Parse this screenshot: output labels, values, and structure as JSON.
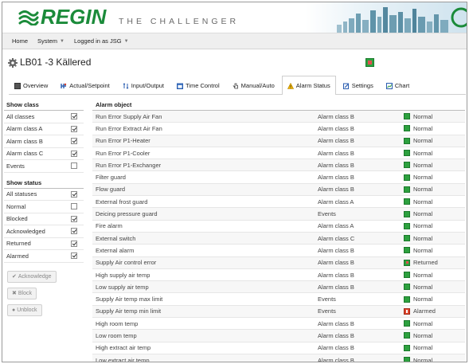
{
  "brand": {
    "logo_text": "REGIN",
    "tagline": "THE CHALLENGER",
    "logo_color": "#1b8b3a"
  },
  "menu": {
    "items": [
      {
        "label": "Home",
        "has_dropdown": false
      },
      {
        "label": "System",
        "has_dropdown": true
      },
      {
        "label": "Logged in as JSG",
        "has_dropdown": true
      }
    ]
  },
  "device": {
    "title": "LB01 -3 Källered",
    "icon": "gear-icon",
    "status_color": "#2da13f"
  },
  "tabs": [
    {
      "label": "Overview",
      "icon": "overview-icon",
      "active": false
    },
    {
      "label": "Actual/Setpoint",
      "icon": "actual-setpoint-icon",
      "active": false
    },
    {
      "label": "Input/Output",
      "icon": "input-output-icon",
      "active": false
    },
    {
      "label": "Time Control",
      "icon": "calendar-icon",
      "active": false
    },
    {
      "label": "Manual/Auto",
      "icon": "hand-icon",
      "active": false
    },
    {
      "label": "Alarm Status",
      "icon": "warning-icon",
      "active": true
    },
    {
      "label": "Settings",
      "icon": "settings-icon",
      "active": false
    },
    {
      "label": "Chart",
      "icon": "chart-icon",
      "active": false
    }
  ],
  "show_class": {
    "title": "Show class",
    "items": [
      {
        "label": "All classes",
        "checked": true
      },
      {
        "label": "Alarm class A",
        "checked": true
      },
      {
        "label": "Alarm class B",
        "checked": true
      },
      {
        "label": "Alarm class C",
        "checked": true
      },
      {
        "label": "Events",
        "checked": false
      }
    ]
  },
  "show_status": {
    "title": "Show status",
    "items": [
      {
        "label": "All statuses",
        "checked": true
      },
      {
        "label": "Normal",
        "checked": false
      },
      {
        "label": "Blocked",
        "checked": true
      },
      {
        "label": "Acknowledged",
        "checked": true
      },
      {
        "label": "Returned",
        "checked": true
      },
      {
        "label": "Alarmed",
        "checked": true
      }
    ]
  },
  "actions": [
    {
      "label": "Acknowledge",
      "icon": "check-icon",
      "glyph": "✔"
    },
    {
      "label": "Block",
      "icon": "close-icon",
      "glyph": "✖"
    },
    {
      "label": "Unblock",
      "icon": "unblock-icon",
      "glyph": "●"
    }
  ],
  "table": {
    "header": "Alarm object",
    "rows": [
      {
        "object": "Run Error Supply Air Fan",
        "class": "Alarm class B",
        "status": "Normal"
      },
      {
        "object": "Run Error Extract Air Fan",
        "class": "Alarm class B",
        "status": "Normal"
      },
      {
        "object": "Run Error P1-Heater",
        "class": "Alarm class B",
        "status": "Normal"
      },
      {
        "object": "Run Error P1-Cooler",
        "class": "Alarm class B",
        "status": "Normal"
      },
      {
        "object": "Run Error P1-Exchanger",
        "class": "Alarm class B",
        "status": "Normal"
      },
      {
        "object": "Filter guard",
        "class": "Alarm class B",
        "status": "Normal"
      },
      {
        "object": "Flow guard",
        "class": "Alarm class B",
        "status": "Normal"
      },
      {
        "object": "External frost guard",
        "class": "Alarm class A",
        "status": "Normal"
      },
      {
        "object": "Deicing pressure guard",
        "class": "Events",
        "status": "Normal"
      },
      {
        "object": "Fire alarm",
        "class": "Alarm class A",
        "status": "Normal"
      },
      {
        "object": "External switch",
        "class": "Alarm class C",
        "status": "Normal"
      },
      {
        "object": "External alarm",
        "class": "Alarm class B",
        "status": "Normal"
      },
      {
        "object": "Supply Air control error",
        "class": "Alarm class B",
        "status": "Returned"
      },
      {
        "object": "High supply air temp",
        "class": "Alarm class B",
        "status": "Normal"
      },
      {
        "object": "Low supply air temp",
        "class": "Alarm class B",
        "status": "Normal"
      },
      {
        "object": "Supply Air temp max limit",
        "class": "Events",
        "status": "Normal"
      },
      {
        "object": "Supply Air temp min limit",
        "class": "Events",
        "status": "Alarmed"
      },
      {
        "object": "High room temp",
        "class": "Alarm class B",
        "status": "Normal"
      },
      {
        "object": "Low room temp",
        "class": "Alarm class B",
        "status": "Normal"
      },
      {
        "object": "High extract air temp",
        "class": "Alarm class B",
        "status": "Normal"
      },
      {
        "object": "Low extract air temp",
        "class": "Alarm class B",
        "status": "Normal"
      }
    ]
  },
  "status_colors": {
    "Normal": "#2da13f",
    "Returned": "#2da13f",
    "Alarmed": "#e0452c"
  }
}
